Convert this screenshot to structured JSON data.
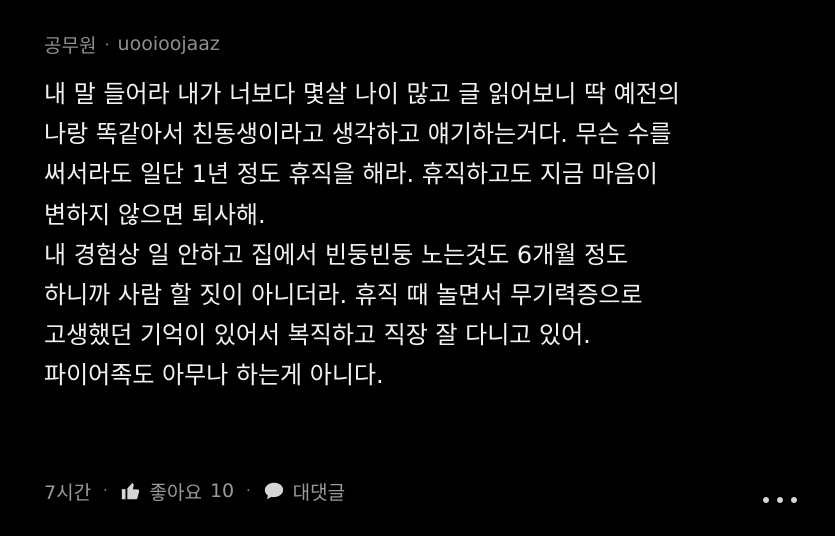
{
  "comment": {
    "author_type": "공무원",
    "separator": "·",
    "username": "uooioojaaz",
    "lines": [
      "내 말 들어라 내가 너보다 몇살 나이 많고 글 읽어보니 딱 예전의",
      "나랑 똑같아서 친동생이라고 생각하고  얘기하는거다. 무슨 수를",
      "써서라도 일단 1년 정도 휴직을 해라. 휴직하고도 지금 마음이",
      "변하지 않으면 퇴사해.",
      "내 경험상 일 안하고 집에서 빈둥빈둥 노는것도 6개월 정도",
      "하니까 사람 할 짓이 아니더라. 휴직 때 놀면서 무기력증으로",
      "고생했던 기억이 있어서 복직하고 직장 잘 다니고 있어.",
      "파이어족도 아무나 하는게 아니다."
    ],
    "footer": {
      "time": "7시간",
      "like_label": "좋아요",
      "like_count": "10",
      "reply_label": "대댓글"
    }
  },
  "colors": {
    "background": "#000000",
    "text": "#f1f1f1",
    "meta": "#8f8f8f"
  },
  "icons": {
    "like": "thumbs-up-icon",
    "reply": "speech-bubble-icon",
    "more": "more-dots-icon"
  }
}
